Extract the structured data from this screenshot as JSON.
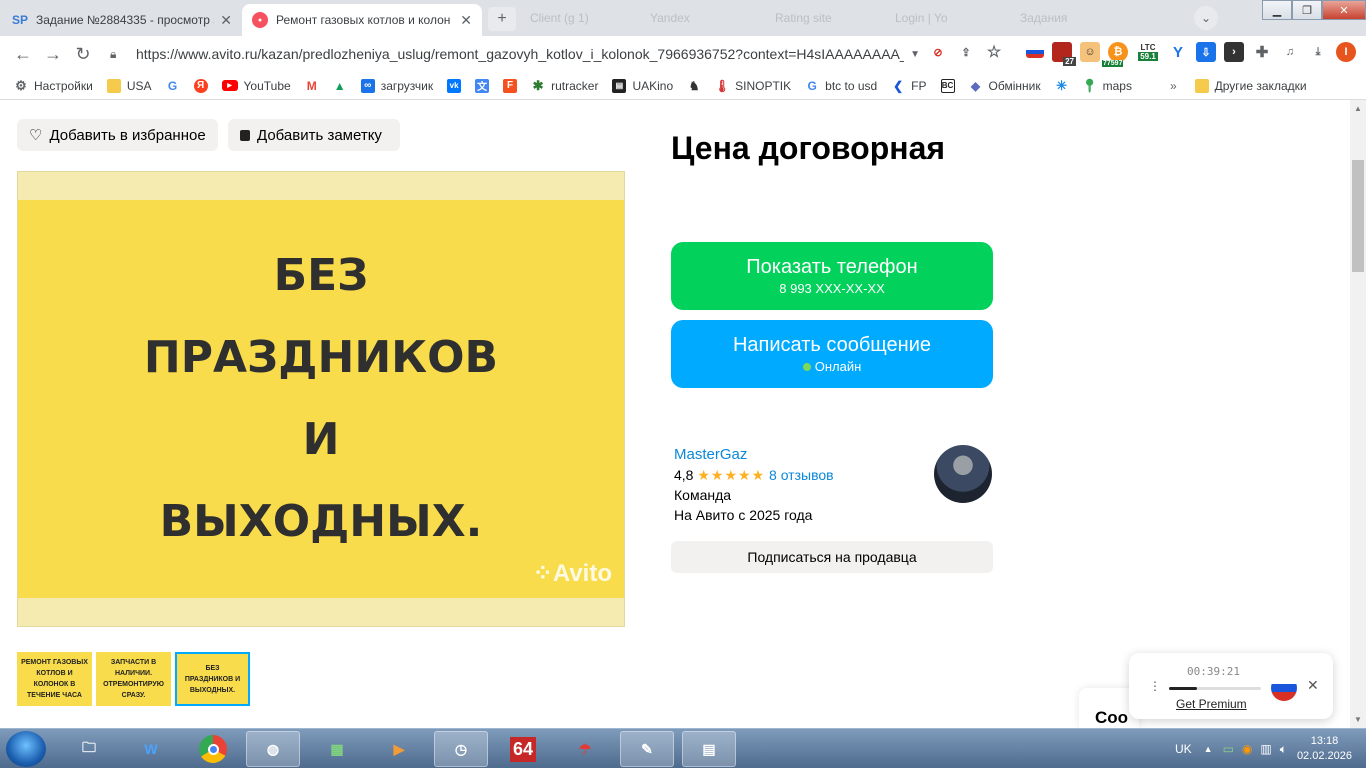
{
  "browser": {
    "tabs": [
      {
        "favicon_text": "SP",
        "title": "Задание №2884335 - просмотр з",
        "active": false
      },
      {
        "favicon_text": "●",
        "title": "Ремонт газовых котлов и колон",
        "active": true
      }
    ],
    "ghost_tabs": [
      "Client (g 1)",
      "Yandex",
      "Rating site",
      "Login | Yo",
      "Задания"
    ],
    "url": "https://www.avito.ru/kazan/predlozheniya_uslug/remont_gazovyh_kotlov_i_kolonok_7966936752?context=H4sIAAAAAAAA_...",
    "badges": {
      "num27": "27",
      "num77597": "77597",
      "ltc_label": "LTC",
      "ltc_value": "59.1",
      "profile_initial": "I"
    },
    "bookmarks": [
      {
        "icon": "gear-icon",
        "label": "Настройки"
      },
      {
        "icon": "folder-icon",
        "label": "USA"
      },
      {
        "icon": "google-icon",
        "label": ""
      },
      {
        "icon": "yandex-icon",
        "label": ""
      },
      {
        "icon": "youtube-icon",
        "label": "YouTube"
      },
      {
        "icon": "gmail-icon",
        "label": ""
      },
      {
        "icon": "drive-icon",
        "label": ""
      },
      {
        "icon": "infinity-icon",
        "label": "загрузчик"
      },
      {
        "icon": "vk-icon",
        "label": ""
      },
      {
        "icon": "translate-icon",
        "label": ""
      },
      {
        "icon": "f-icon",
        "label": ""
      },
      {
        "icon": "rutracker-icon",
        "label": "rutracker"
      },
      {
        "icon": "uakino-icon",
        "label": "UAKino"
      },
      {
        "icon": "sinoptik-icon",
        "label": "SINOPTIK"
      },
      {
        "icon": "google-icon",
        "label": "btc to usd"
      },
      {
        "icon": "fp-icon",
        "label": "FP"
      },
      {
        "icon": "bc-icon",
        "label": ""
      },
      {
        "icon": "exchanger-icon",
        "label": "Обмінник"
      },
      {
        "icon": "star-icon",
        "label": ""
      },
      {
        "icon": "maps-icon",
        "label": "maps"
      }
    ],
    "more_bookmarks": "»",
    "other_bookmarks": "Другие закладки"
  },
  "page": {
    "favorite_button": "Добавить в избранное",
    "note_button": "Добавить заметку",
    "main_image_text": "БЕЗ\nПРАЗДНИКОВ\nИ\nВЫХОДНЫХ.",
    "watermark": "Avito",
    "thumbnails": [
      {
        "text": "РЕМОНТ ГАЗОВЫХ КОТЛОВ И КОЛОНОК В ТЕЧЕНИЕ ЧАСА",
        "selected": false
      },
      {
        "text": "ЗАПЧАСТИ В НАЛИЧИИ. ОТРЕМОНТИРУЮ СРАЗУ.",
        "selected": false
      },
      {
        "text": "БЕЗ ПРАЗДНИКОВ И ВЫХОДНЫХ.",
        "selected": true
      }
    ],
    "price": "Цена договорная",
    "phone_button": {
      "label": "Показать телефон",
      "sub": "8 993 XXX-XX-XX",
      "color": "#02d15c"
    },
    "message_button": {
      "label": "Написать сообщение",
      "sub": "Онлайн",
      "color": "#00aaff"
    },
    "seller": {
      "name": "MasterGaz",
      "rating": "4,8",
      "stars": "★★★★★",
      "reviews": "8 отзывов",
      "type": "Команда",
      "since": "На Авито с 2025 года"
    },
    "subscribe_button": "Подписаться на продавца",
    "coo_text": "Coo"
  },
  "recorder": {
    "time": "00:39:21",
    "premium": "Get Premium",
    "progress": 0.3
  },
  "taskbar": {
    "lang": "UK",
    "time": "13:18",
    "date": "02.02.2026",
    "app64": "64"
  }
}
